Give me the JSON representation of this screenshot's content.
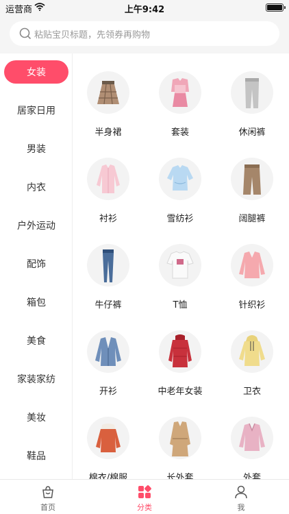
{
  "status_bar": {
    "carrier": "运营商",
    "time": "上午9:42"
  },
  "search": {
    "placeholder": "粘贴宝贝标题，先领券再购物"
  },
  "sidebar": {
    "items": [
      {
        "label": "女装",
        "active": true
      },
      {
        "label": "居家日用"
      },
      {
        "label": "男装"
      },
      {
        "label": "内衣"
      },
      {
        "label": "户外运动"
      },
      {
        "label": "配饰"
      },
      {
        "label": "箱包"
      },
      {
        "label": "美食"
      },
      {
        "label": "家装家纺"
      },
      {
        "label": "美妆"
      },
      {
        "label": "鞋品"
      }
    ]
  },
  "categories": [
    {
      "label": "半身裙",
      "icon": "skirt-icon"
    },
    {
      "label": "套装",
      "icon": "suit-set-icon"
    },
    {
      "label": "休闲裤",
      "icon": "casual-pants-icon"
    },
    {
      "label": "衬衫",
      "icon": "shirt-icon"
    },
    {
      "label": "雪纺衫",
      "icon": "chiffon-top-icon"
    },
    {
      "label": "阔腿裤",
      "icon": "wide-leg-pants-icon"
    },
    {
      "label": "牛仔裤",
      "icon": "jeans-icon"
    },
    {
      "label": "T恤",
      "icon": "tshirt-icon"
    },
    {
      "label": "针织衫",
      "icon": "knit-sweater-icon"
    },
    {
      "label": "开衫",
      "icon": "cardigan-icon"
    },
    {
      "label": "中老年女装",
      "icon": "padded-coat-icon"
    },
    {
      "label": "卫衣",
      "icon": "hoodie-icon"
    },
    {
      "label": "棉衣/棉服",
      "icon": "cotton-coat-icon"
    },
    {
      "label": "长外套",
      "icon": "trench-coat-icon"
    },
    {
      "label": "外套",
      "icon": "jacket-icon"
    }
  ],
  "tab_bar": {
    "tabs": [
      {
        "label": "首页",
        "icon": "shopping-bag-icon"
      },
      {
        "label": "分类",
        "icon": "category-grid-icon",
        "active": true
      },
      {
        "label": "我",
        "icon": "person-icon"
      }
    ]
  },
  "colors": {
    "accent": "#ff4d6a",
    "background": "#f5f5f5"
  }
}
